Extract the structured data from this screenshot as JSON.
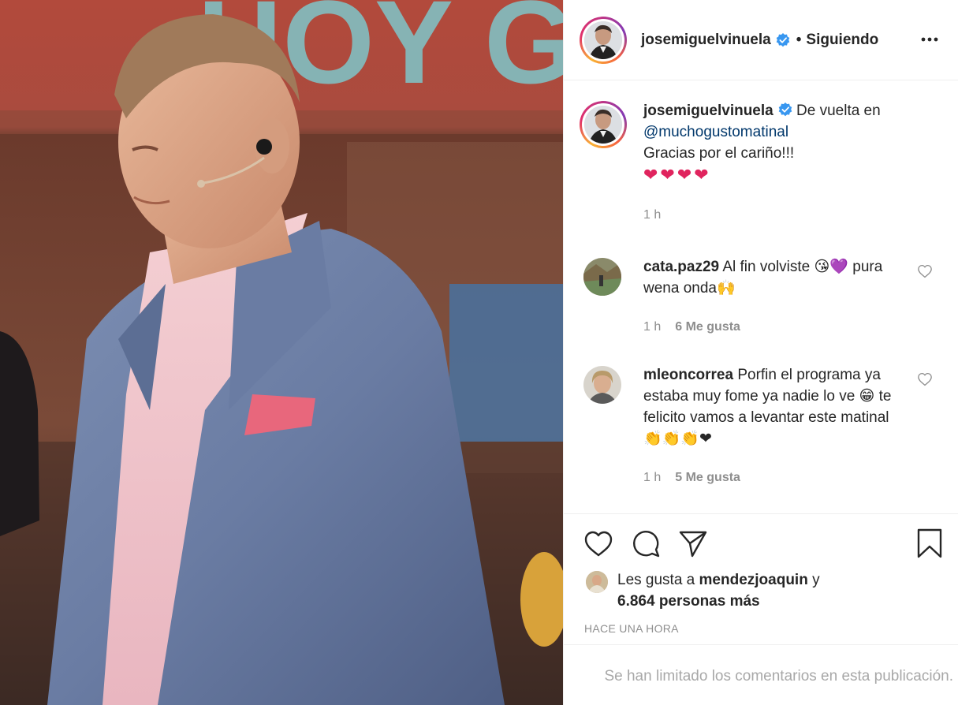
{
  "post": {
    "username": "josemiguelvinuela",
    "follow_status": "Siguiendo",
    "header_separator": "•",
    "photo_sign_text": "HOY GI",
    "more_icon": "more-horizontal-icon",
    "verified_icon": "verified-badge-icon"
  },
  "caption": {
    "username": "josemiguelvinuela",
    "text_line1": "De vuelta en",
    "mention": "@muchogustomatinal",
    "text_line2": "Gracias por el cariño!!!",
    "emojis": "❤❤❤❤",
    "time": "1 h"
  },
  "comments": [
    {
      "username": "cata.paz29",
      "text": "Al fin volviste 😘💜 pura wena onda🙌",
      "time": "1 h",
      "likes": "6 Me gusta"
    },
    {
      "username": "mleoncorrea",
      "text": "Porfin el programa ya estaba muy fome ya nadie lo ve 😁 te felicito vamos a levantar este matinal 👏👏👏❤",
      "time": "1 h",
      "likes": "5 Me gusta"
    }
  ],
  "actions": {
    "like_icon": "heart-icon",
    "comment_icon": "comment-icon",
    "share_icon": "send-icon",
    "save_icon": "bookmark-icon"
  },
  "likes": {
    "prefix": "Les gusta a",
    "user": "mendezjoaquin",
    "connector": "y",
    "others": "6.864 personas más"
  },
  "time_ago": "HACE UNA HORA",
  "comments_limited": "Se han limitado los comentarios en esta publicación.",
  "colors": {
    "text": "#262626",
    "muted": "#8e8e8e",
    "mention": "#00376b",
    "verified": "#3897f0",
    "border": "#efefef"
  }
}
